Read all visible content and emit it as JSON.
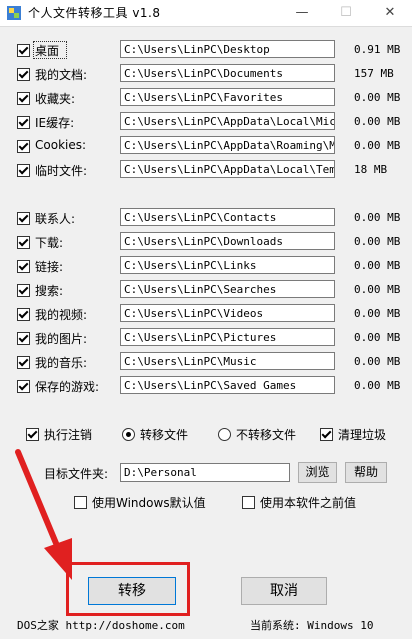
{
  "window": {
    "title": "个人文件转移工具 v1.8",
    "minimize": "—",
    "maximize": "☐",
    "close": "✕"
  },
  "folders_group1": [
    {
      "label": "桌面",
      "path": "C:\\Users\\LinPC\\Desktop",
      "size": "0.91 MB",
      "checked": true
    },
    {
      "label": "我的文档:",
      "path": "C:\\Users\\LinPC\\Documents",
      "size": "157 MB",
      "checked": true
    },
    {
      "label": "收藏夹:",
      "path": "C:\\Users\\LinPC\\Favorites",
      "size": "0.00 MB",
      "checked": true
    },
    {
      "label": "IE缓存:",
      "path": "C:\\Users\\LinPC\\AppData\\Local\\Microso",
      "size": "0.00 MB",
      "checked": true
    },
    {
      "label": "Cookies:",
      "path": "C:\\Users\\LinPC\\AppData\\Roaming\\Micro",
      "size": "0.00 MB",
      "checked": true
    },
    {
      "label": "临时文件:",
      "path": "C:\\Users\\LinPC\\AppData\\Local\\Temp",
      "size": "18 MB",
      "checked": true
    }
  ],
  "folders_group2": [
    {
      "label": "联系人:",
      "path": "C:\\Users\\LinPC\\Contacts",
      "size": "0.00 MB",
      "checked": true
    },
    {
      "label": "下载:",
      "path": "C:\\Users\\LinPC\\Downloads",
      "size": "0.00 MB",
      "checked": true
    },
    {
      "label": "链接:",
      "path": "C:\\Users\\LinPC\\Links",
      "size": "0.00 MB",
      "checked": true
    },
    {
      "label": "搜索:",
      "path": "C:\\Users\\LinPC\\Searches",
      "size": "0.00 MB",
      "checked": true
    },
    {
      "label": "我的视频:",
      "path": "C:\\Users\\LinPC\\Videos",
      "size": "0.00 MB",
      "checked": true
    },
    {
      "label": "我的图片:",
      "path": "C:\\Users\\LinPC\\Pictures",
      "size": "0.00 MB",
      "checked": true
    },
    {
      "label": "我的音乐:",
      "path": "C:\\Users\\LinPC\\Music",
      "size": "0.00 MB",
      "checked": true
    },
    {
      "label": "保存的游戏:",
      "path": "C:\\Users\\LinPC\\Saved Games",
      "size": "0.00 MB",
      "checked": true
    }
  ],
  "options": {
    "logoff_label": "执行注销",
    "transfer_label": "转移文件",
    "no_transfer_label": "不转移文件",
    "cleanup_label": "清理垃圾"
  },
  "target": {
    "label": "目标文件夹:",
    "value": "D:\\Personal",
    "browse": "浏览",
    "help": "帮助"
  },
  "defaults": {
    "windows_default": "使用Windows默认值",
    "previous_value": "使用本软件之前值"
  },
  "actions": {
    "transfer": "转移",
    "cancel": "取消"
  },
  "footer": {
    "site": "DOS之家 http://doshome.com",
    "system": "当前系统: Windows 10"
  },
  "colors": {
    "annotation_red": "#e02020"
  }
}
